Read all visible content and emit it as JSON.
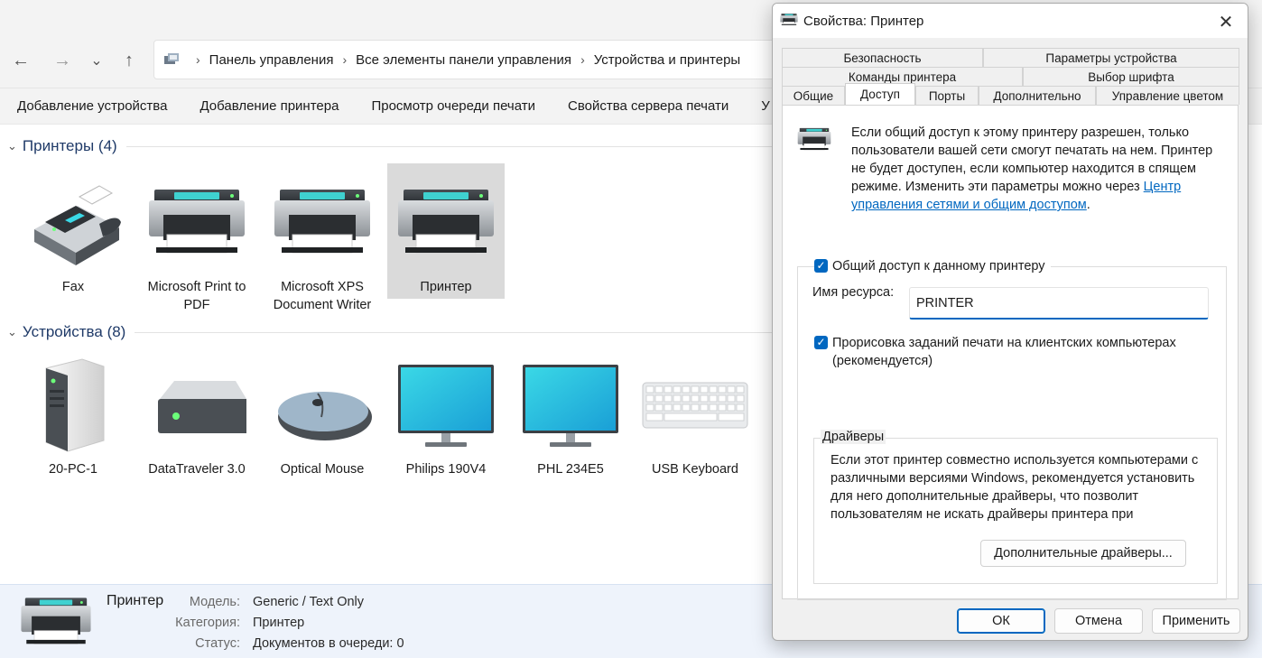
{
  "nav": {
    "back_icon": "←",
    "forward_icon": "→",
    "dropdown_icon": "⌄",
    "up_icon": "↑",
    "breadcrumb": [
      "Панель управления",
      "Все элементы панели управления",
      "Устройства и принтеры"
    ],
    "separator": "›"
  },
  "commands": [
    "Добавление устройства",
    "Добавление принтера",
    "Просмотр очереди печати",
    "Свойства сервера печати",
    "У"
  ],
  "printers": {
    "header": "Принтеры (4)",
    "items": [
      "Fax",
      "Microsoft Print to PDF",
      "Microsoft XPS Document Writer",
      "Принтер"
    ]
  },
  "devices": {
    "header": "Устройства (8)",
    "items": [
      "20-PC-1",
      "DataTraveler 3.0",
      "Optical Mouse",
      "Philips 190V4",
      "PHL 234E5",
      "USB Keyboard"
    ]
  },
  "details": {
    "name": "Принтер",
    "model_label": "Модель:",
    "model_value": "Generic / Text Only",
    "category_label": "Категория:",
    "category_value": "Принтер",
    "status_label": "Статус:",
    "status_value": "Документов в очереди: 0"
  },
  "dialog": {
    "title": "Свойства: Принтер",
    "close_icon": "✕",
    "tabs_row1": [
      "Безопасность",
      "Параметры устройства"
    ],
    "tabs_row2": [
      "Команды принтера",
      "Выбор шрифта"
    ],
    "tabs_row3": [
      "Общие",
      "Доступ",
      "Порты",
      "Дополнительно",
      "Управление цветом"
    ],
    "active_tab": "Доступ",
    "intro_text": "Если общий доступ к этому принтеру разрешен, только пользователи вашей сети смогут печатать на нем. Принтер не будет доступен, если компьютер находится в спящем режиме. Изменить эти параметры можно через ",
    "intro_link": "Центр управления сетями и общим доступом",
    "intro_end": ".",
    "share_checkbox": "Общий доступ к данному принтеру",
    "share_checked": true,
    "resource_label": "Имя ресурса:",
    "resource_value": "PRINTER",
    "render_checkbox": "Прорисовка заданий печати на клиентских компьютерах (рекомендуется)",
    "render_checked": true,
    "drivers_legend": "Драйверы",
    "drivers_text": "Если этот принтер совместно используется компьютерами с различными версиями Windows, рекомендуется установить для него дополнительные драйверы, что позволит пользователям не искать драйверы принтера при подключении к нему.",
    "drivers_button": "Дополнительные драйверы...",
    "ok": "ОК",
    "cancel": "Отмена",
    "apply": "Применить",
    "check_mark": "✓"
  },
  "colors": {
    "accent": "#0067c0",
    "header_text": "#1f3a68",
    "selected_item": "#dadada",
    "details_bg": "#eef3fb"
  }
}
